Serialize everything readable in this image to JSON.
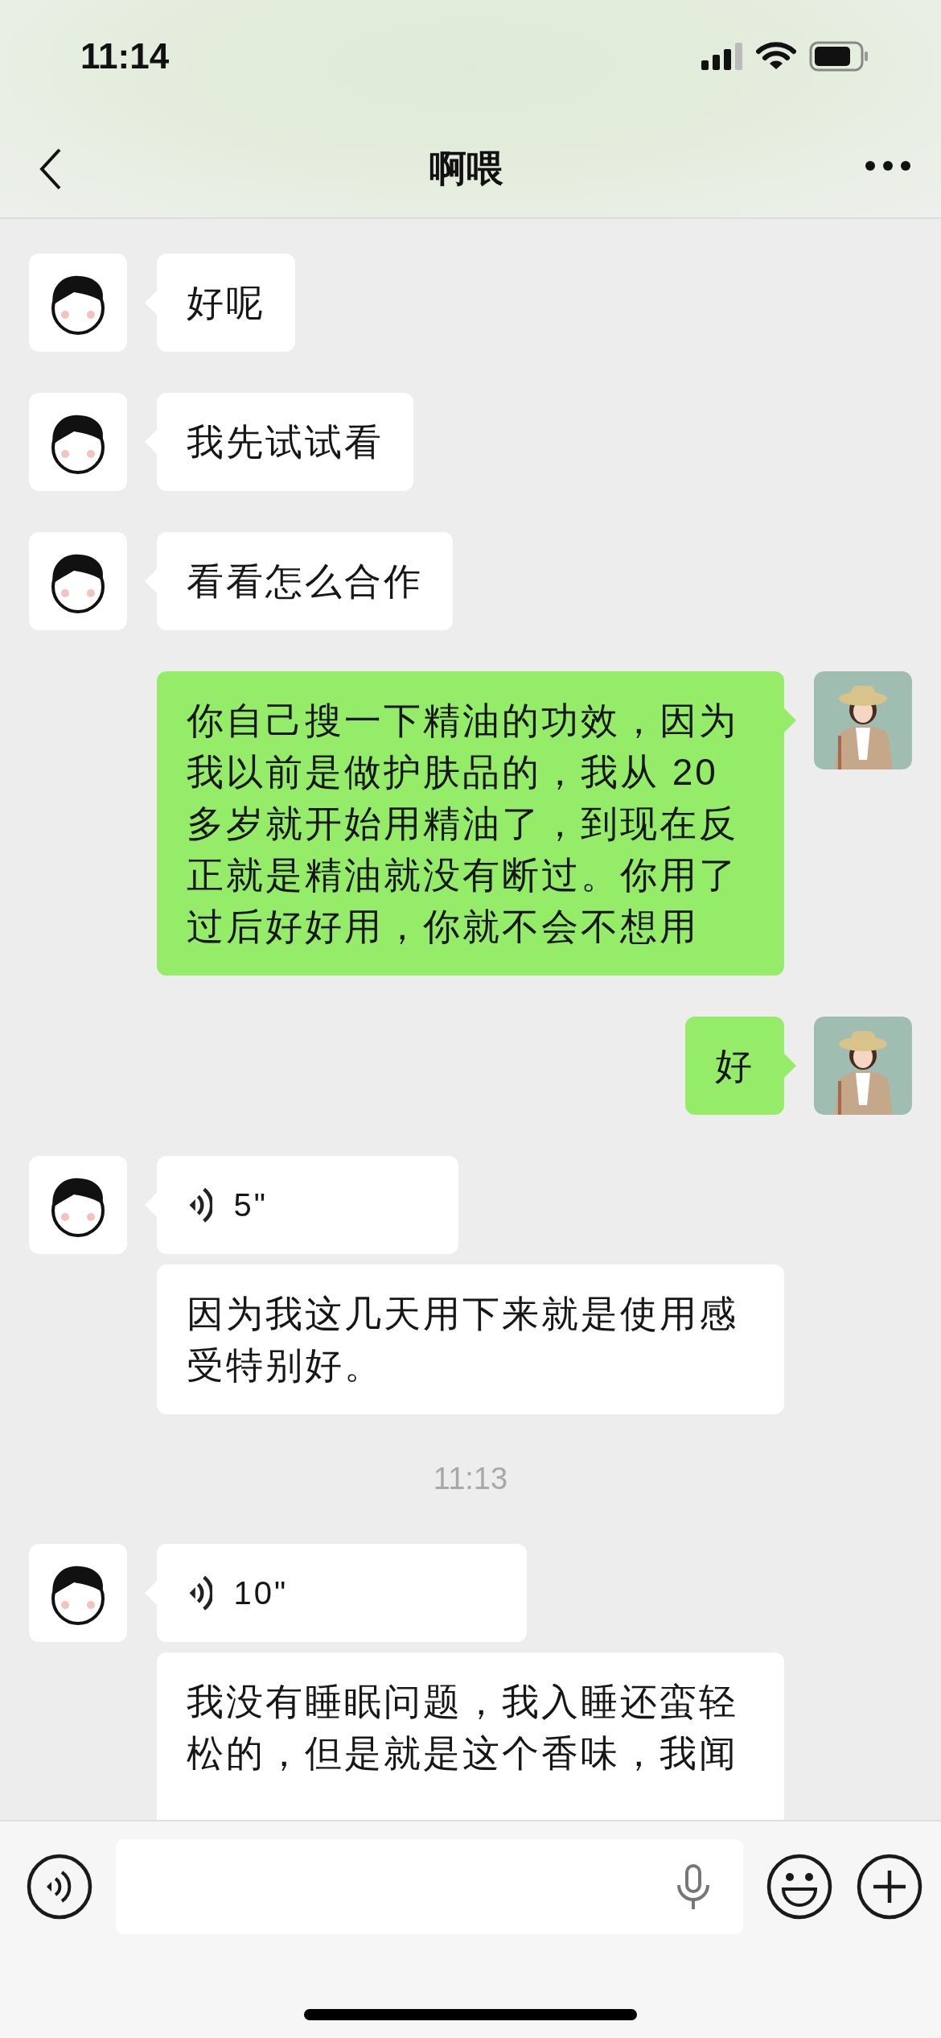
{
  "status_bar": {
    "time": "11:14"
  },
  "nav": {
    "title": "啊喂"
  },
  "items": [
    {
      "kind": "group",
      "outgoing": false,
      "bubbles": [
        {
          "kind": "text",
          "text": "好呢"
        }
      ]
    },
    {
      "kind": "group",
      "outgoing": false,
      "bubbles": [
        {
          "kind": "text",
          "text": "我先试试看"
        }
      ]
    },
    {
      "kind": "group",
      "outgoing": false,
      "bubbles": [
        {
          "kind": "text",
          "text": "看看怎么合作"
        }
      ]
    },
    {
      "kind": "group",
      "outgoing": true,
      "bubbles": [
        {
          "kind": "text",
          "text": "你自己搜一下精油的功效，因为我以前是做护肤品的，我从 20 多岁就开始用精油了，到现在反正就是精油就没有断过。你用了过后好好用，你就不会不想用"
        }
      ]
    },
    {
      "kind": "group",
      "outgoing": true,
      "bubbles": [
        {
          "kind": "text",
          "text": "好"
        }
      ]
    },
    {
      "kind": "group",
      "outgoing": false,
      "bubbles": [
        {
          "kind": "voice",
          "duration": "5\""
        },
        {
          "kind": "text",
          "text": "因为我这几天用下来就是使用感受特别好。"
        }
      ]
    },
    {
      "kind": "time",
      "text": "11:13"
    },
    {
      "kind": "group",
      "outgoing": false,
      "bubbles": [
        {
          "kind": "voice",
          "duration": "10\""
        },
        {
          "kind": "text",
          "text": "我没有睡眠问题，我入睡还蛮轻松的，但是就是这个香味，我闻",
          "cut": true
        }
      ]
    }
  ]
}
